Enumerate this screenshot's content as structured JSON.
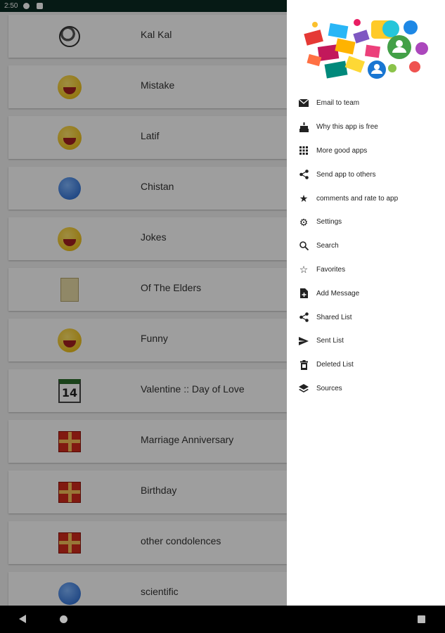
{
  "status_bar": {
    "time": "2:50"
  },
  "list": {
    "items": [
      {
        "label": "Kal Kal",
        "icon": "soccer-ball-icon"
      },
      {
        "label": "Mistake",
        "icon": "laughing-smiley-icon"
      },
      {
        "label": "Latif",
        "icon": "laughing-smiley-icon"
      },
      {
        "label": "Chistan",
        "icon": "blue-face-icon"
      },
      {
        "label": "Jokes",
        "icon": "laughing-smiley-icon"
      },
      {
        "label": "Of The Elders",
        "icon": "scroll-icon"
      },
      {
        "label": "Funny",
        "icon": "laughing-smiley-icon"
      },
      {
        "label": "Valentine :: Day of Love",
        "icon": "calendar-icon"
      },
      {
        "label": "Marriage Anniversary",
        "icon": "gift-icon"
      },
      {
        "label": "Birthday",
        "icon": "gift-icon"
      },
      {
        "label": "other condolences",
        "icon": "gift-icon"
      },
      {
        "label": "scientific",
        "icon": "blue-face-icon"
      }
    ],
    "calendar_day": "14"
  },
  "drawer": {
    "header_image": "messaging-collage-image",
    "menu": [
      {
        "label": "Email to team",
        "icon": "mail-icon"
      },
      {
        "label": "Why this app is free",
        "icon": "cake-icon"
      },
      {
        "label": "More good apps",
        "icon": "apps-grid-icon"
      },
      {
        "label": "Send app to others",
        "icon": "share-icon"
      },
      {
        "label": "comments and rate to app",
        "icon": "star-filled-icon"
      },
      {
        "label": "Settings",
        "icon": "gear-icon"
      },
      {
        "label": "Search",
        "icon": "search-icon"
      },
      {
        "label": "Favorites",
        "icon": "star-outline-icon"
      },
      {
        "label": "Add Message",
        "icon": "add-document-icon"
      },
      {
        "label": "Shared List",
        "icon": "share-icon"
      },
      {
        "label": "Sent List",
        "icon": "send-icon"
      },
      {
        "label": "Deleted List",
        "icon": "trash-icon"
      },
      {
        "label": "Sources",
        "icon": "layers-icon"
      }
    ]
  },
  "colors": {
    "status_bar": "#0a2a22",
    "scrim": "rgba(0,0,0,0.38)",
    "drawer_bg": "#ffffff"
  }
}
